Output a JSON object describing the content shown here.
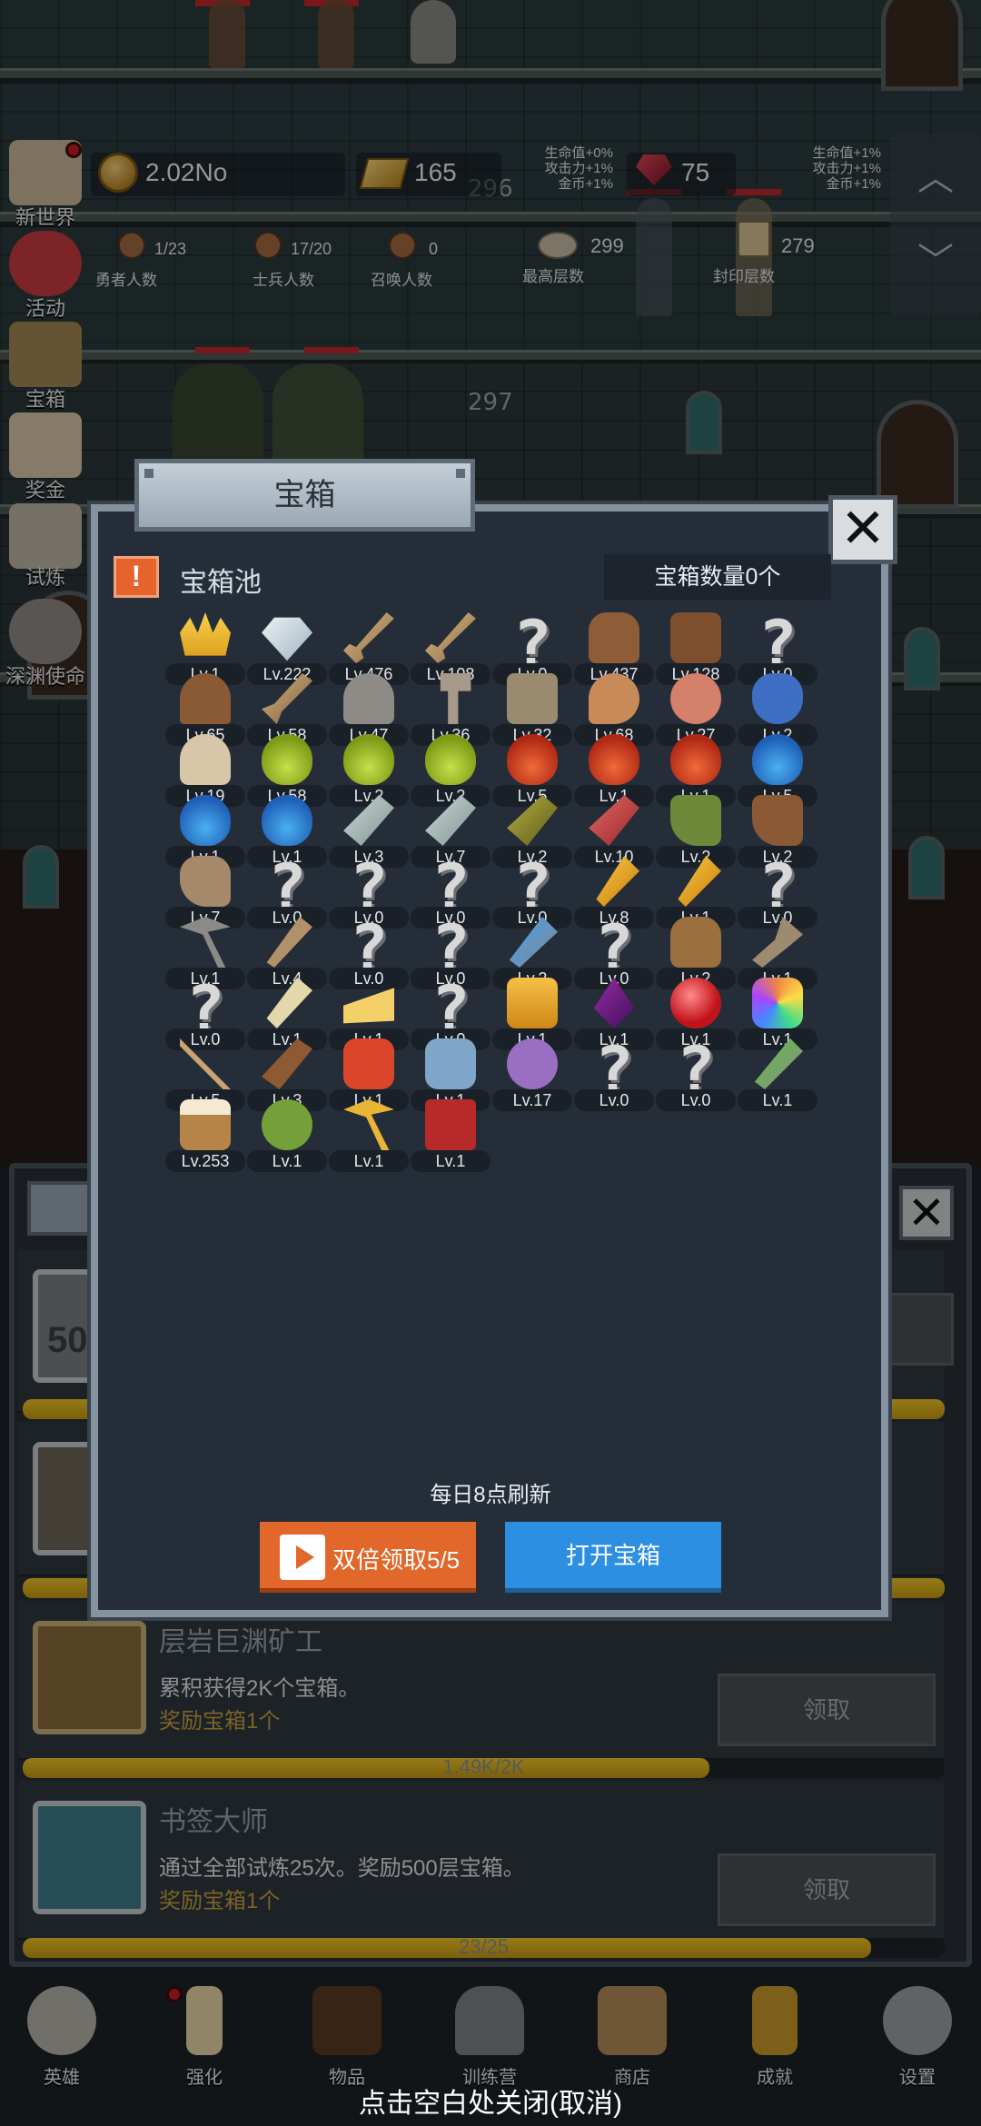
{
  "stats": {
    "coins": "2.02No",
    "gold": "165",
    "gems": "75",
    "floor_current": "296",
    "floor_next": "297",
    "buffs_left": [
      "生命值+0%",
      "攻击力+1%",
      "金币+1%"
    ],
    "buffs_right": [
      "生命值+1%",
      "攻击力+1%",
      "金币+1%"
    ],
    "heroes_value": "1/23",
    "heroes_label": "勇者人数",
    "soldiers_value": "17/20",
    "soldiers_label": "士兵人数",
    "summon_value": "0",
    "summon_label": "召唤人数",
    "highest_value": "299",
    "highest_label": "最高层数",
    "sealed_value": "279",
    "sealed_label": "封印层数"
  },
  "sidebar": {
    "items": [
      {
        "label": "新世界"
      },
      {
        "label": "活动"
      },
      {
        "label": "宝箱"
      },
      {
        "label": "奖金"
      },
      {
        "label": "试炼"
      },
      {
        "label": "深渊使命"
      }
    ]
  },
  "modal": {
    "title": "宝箱",
    "pool_flag": "!",
    "pool_title": "宝箱池",
    "chest_count": "宝箱数量0个",
    "refresh_note": "每日8点刷新",
    "double_button": "双倍领取5/5",
    "open_button": "打开宝箱",
    "items": [
      {
        "icon": "crown",
        "level": "Lv.1"
      },
      {
        "icon": "diamond",
        "level": "Lv.222"
      },
      {
        "icon": "sword",
        "level": "Lv.476"
      },
      {
        "icon": "sword",
        "level": "Lv.108"
      },
      {
        "icon": "unknown",
        "level": "Lv.0"
      },
      {
        "icon": "leather-armor",
        "level": "Lv.437"
      },
      {
        "icon": "leather-vest",
        "level": "Lv.128"
      },
      {
        "icon": "unknown",
        "level": "Lv.0"
      },
      {
        "icon": "leather-helmet",
        "level": "Lv.65"
      },
      {
        "icon": "dagger",
        "level": "Lv.58"
      },
      {
        "icon": "knight-helmet",
        "level": "Lv.47"
      },
      {
        "icon": "hammer",
        "level": "Lv.36"
      },
      {
        "icon": "great-helm",
        "level": "Lv.32"
      },
      {
        "icon": "meat-leg",
        "level": "Lv.68"
      },
      {
        "icon": "steak",
        "level": "Lv.27"
      },
      {
        "icon": "sack",
        "level": "Lv.2"
      },
      {
        "icon": "bread",
        "level": "Lv.19"
      },
      {
        "icon": "potion-yellow",
        "level": "Lv.58"
      },
      {
        "icon": "potion-yellow",
        "level": "Lv.2"
      },
      {
        "icon": "potion-yellow",
        "level": "Lv.2"
      },
      {
        "icon": "potion-red",
        "level": "Lv.5"
      },
      {
        "icon": "potion-red",
        "level": "Lv.1"
      },
      {
        "icon": "potion-red",
        "level": "Lv.1"
      },
      {
        "icon": "potion-blue",
        "level": "Lv.5"
      },
      {
        "icon": "potion-blue",
        "level": "Lv.1"
      },
      {
        "icon": "potion-blue",
        "level": "Lv.1"
      },
      {
        "icon": "vial-grey",
        "level": "Lv.3"
      },
      {
        "icon": "vial-grey",
        "level": "Lv.7"
      },
      {
        "icon": "bottle-olive",
        "level": "Lv.2"
      },
      {
        "icon": "bottle-red",
        "level": "Lv.10"
      },
      {
        "icon": "winged-boot",
        "level": "Lv.2"
      },
      {
        "icon": "boot",
        "level": "Lv.2"
      },
      {
        "icon": "shoe",
        "level": "Lv.7"
      },
      {
        "icon": "unknown",
        "level": "Lv.0"
      },
      {
        "icon": "unknown",
        "level": "Lv.0"
      },
      {
        "icon": "unknown",
        "level": "Lv.0"
      },
      {
        "icon": "unknown",
        "level": "Lv.0"
      },
      {
        "icon": "torch",
        "level": "Lv.8"
      },
      {
        "icon": "torch",
        "level": "Lv.1"
      },
      {
        "icon": "unknown",
        "level": "Lv.0"
      },
      {
        "icon": "pickaxe",
        "level": "Lv.1"
      },
      {
        "icon": "staff",
        "level": "Lv.4"
      },
      {
        "icon": "unknown",
        "level": "Lv.0"
      },
      {
        "icon": "unknown",
        "level": "Lv.0"
      },
      {
        "icon": "wand-blue",
        "level": "Lv.2"
      },
      {
        "icon": "unknown",
        "level": "Lv.0"
      },
      {
        "icon": "backpack",
        "level": "Lv.2"
      },
      {
        "icon": "shovel",
        "level": "Lv.1"
      },
      {
        "icon": "unknown",
        "level": "Lv.0"
      },
      {
        "icon": "bone-club",
        "level": "Lv.1"
      },
      {
        "icon": "cheese",
        "level": "Lv.1"
      },
      {
        "icon": "unknown",
        "level": "Lv.0"
      },
      {
        "icon": "honey-jar",
        "level": "Lv.1"
      },
      {
        "icon": "dark-crystal",
        "level": "Lv.1"
      },
      {
        "icon": "red-orb",
        "level": "Lv.1"
      },
      {
        "icon": "rainbow-gem",
        "level": "Lv.1"
      },
      {
        "icon": "bow",
        "level": "Lv.5"
      },
      {
        "icon": "quiver",
        "level": "Lv.3"
      },
      {
        "icon": "fire-gauntlet",
        "level": "Lv.1"
      },
      {
        "icon": "ice-gauntlet",
        "level": "Lv.1"
      },
      {
        "icon": "tentacle",
        "level": "Lv.17"
      },
      {
        "icon": "unknown",
        "level": "Lv.0"
      },
      {
        "icon": "unknown",
        "level": "Lv.0"
      },
      {
        "icon": "green-scepter",
        "level": "Lv.1"
      },
      {
        "icon": "beer-mug",
        "level": "Lv.253"
      },
      {
        "icon": "vine",
        "level": "Lv.1"
      },
      {
        "icon": "golden-pickaxe",
        "level": "Lv.1"
      },
      {
        "icon": "red-book",
        "level": "Lv.1"
      }
    ]
  },
  "achievements": {
    "rows": [
      {
        "title": "层岩巨渊矿工",
        "desc": "累积获得2K个宝箱。",
        "reward": "奖励宝箱1个",
        "button": "领取",
        "progress_text": "1.49K/2K",
        "progress": 0.745
      },
      {
        "title": "书签大师",
        "desc": "通过全部试炼25次。奖励500层宝箱。",
        "reward": "奖励宝箱1个",
        "button": "领取",
        "progress_text": "23/25",
        "progress": 0.92
      }
    ],
    "partial_label": "50"
  },
  "nav": {
    "items": [
      {
        "label": "英雄"
      },
      {
        "label": "强化"
      },
      {
        "label": "物品"
      },
      {
        "label": "训练营"
      },
      {
        "label": "商店"
      },
      {
        "label": "成就"
      },
      {
        "label": "设置"
      }
    ]
  },
  "dismiss_hint": "点击空白处关闭(取消)",
  "colors": {
    "accent_orange": "#e1672a",
    "accent_blue": "#2c8fe2",
    "reward_gold": "#c9a13e",
    "progress_gold": "#f0c62b"
  }
}
